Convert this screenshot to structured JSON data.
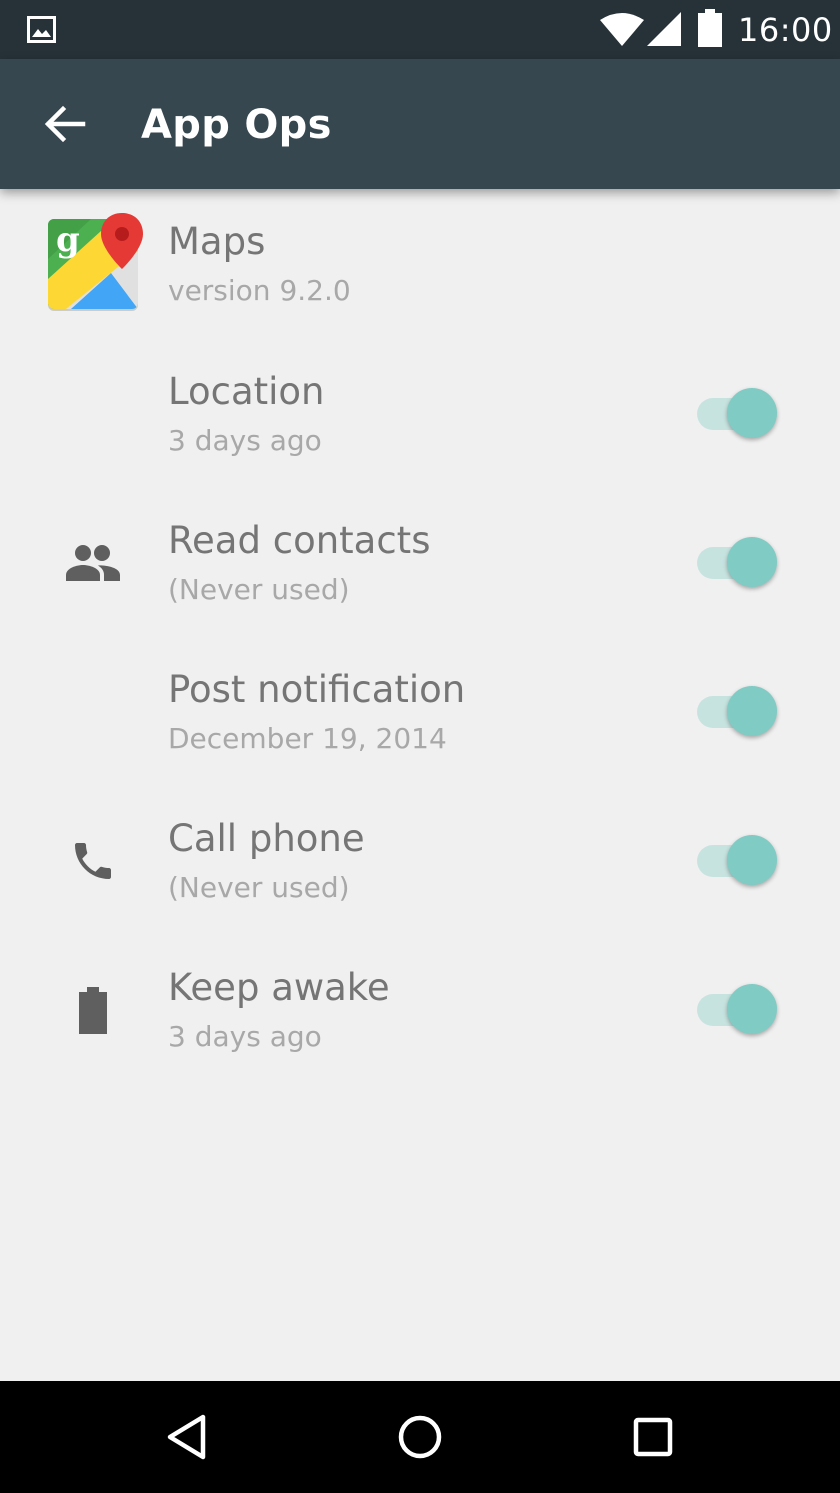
{
  "status_bar": {
    "time": "16:00",
    "icons": [
      "image-notification-icon",
      "wifi-icon",
      "cell-signal-icon",
      "battery-icon"
    ]
  },
  "app_bar": {
    "title": "App Ops",
    "back_icon": "arrow-back-icon",
    "background": "#37474f"
  },
  "app": {
    "name": "Maps",
    "version": "version 9.2.0",
    "icon": "google-maps-icon"
  },
  "ops": [
    {
      "title": "Location",
      "subtitle": "3 days ago",
      "icon": "",
      "enabled": true
    },
    {
      "title": "Read contacts",
      "subtitle": "(Never used)",
      "icon": "people-icon",
      "enabled": true
    },
    {
      "title": "Post notification",
      "subtitle": "December 19, 2014",
      "icon": "",
      "enabled": true
    },
    {
      "title": "Call phone",
      "subtitle": "(Never used)",
      "icon": "phone-icon",
      "enabled": true
    },
    {
      "title": "Keep awake",
      "subtitle": "3 days ago",
      "icon": "battery-icon",
      "enabled": true
    }
  ],
  "colors": {
    "status_bar": "#263238",
    "toggle_thumb": "#80cbc4",
    "toggle_track": "#c7e3e0",
    "background": "#f0f0f0"
  },
  "nav_bar": {
    "buttons": [
      "back-triangle-icon",
      "home-circle-icon",
      "recents-square-icon"
    ]
  }
}
